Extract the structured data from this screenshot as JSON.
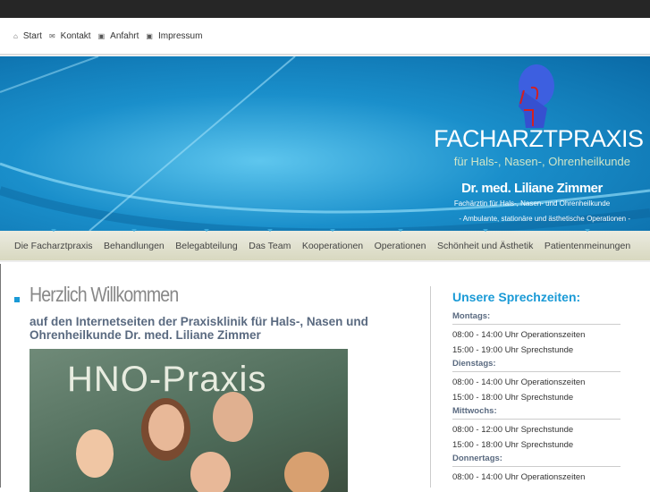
{
  "toplinks": [
    {
      "label": "Start",
      "icon": "home-icon"
    },
    {
      "label": "Kontakt",
      "icon": "mail-icon"
    },
    {
      "label": "Anfahrt",
      "icon": "map-icon"
    },
    {
      "label": "Impressum",
      "icon": "info-icon"
    }
  ],
  "banner": {
    "title": "FACHARZTPRAXIS",
    "subtitle": "für Hals-, Nasen-, Ohrenheilkunde",
    "doctor": "Dr. med. Liliane Zimmer",
    "specialty": "Fachärztin für Hals-, Nasen- und Ohrenheilkunde",
    "operations": "- Ambulante, stationäre und ästhetische Operationen -"
  },
  "nav": [
    "Die Facharztpraxis",
    "Behandlungen",
    "Belegabteilung",
    "Das Team",
    "Kooperationen",
    "Operationen",
    "Schönheit und Ästhetik",
    "Patientenmeinungen"
  ],
  "main": {
    "heading": "Herzlich Willkommen",
    "intro": "auf den Internetseiten der Praxisklinik für Hals-, Nasen und Ohrenheilkunde Dr. med. Liliane Zimmer",
    "photo_sign": "HNO-Praxis"
  },
  "hours": {
    "title": "Unsere Sprechzeiten:",
    "days": [
      {
        "day": "Montags:",
        "slots": [
          "08:00 - 14:00 Uhr Operationszeiten",
          "15:00 - 19:00 Uhr Sprechstunde"
        ]
      },
      {
        "day": "Dienstags:",
        "slots": [
          "08:00 - 14:00 Uhr Operationszeiten",
          "15:00 - 18:00 Uhr Sprechstunde"
        ]
      },
      {
        "day": "Mittwochs:",
        "slots": [
          "08:00 - 12:00 Uhr Sprechstunde",
          "15:00 - 18:00 Uhr Sprechstunde"
        ]
      },
      {
        "day": "Donnertags:",
        "slots": [
          "08:00 - 14:00 Uhr Operationszeiten"
        ]
      }
    ]
  }
}
